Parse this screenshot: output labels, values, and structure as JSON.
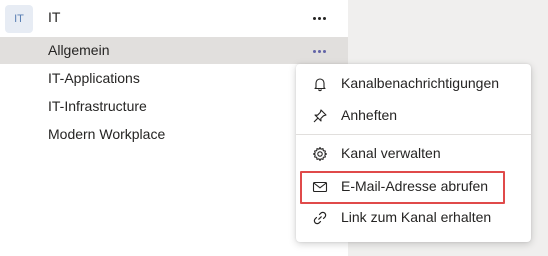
{
  "team": {
    "avatar_text": "IT",
    "name": "IT",
    "more_icon": "ellipsis-icon"
  },
  "channels": [
    {
      "label": "Allgemein",
      "selected": true
    },
    {
      "label": "IT-Applications",
      "selected": false
    },
    {
      "label": "IT-Infrastructure",
      "selected": false
    },
    {
      "label": "Modern Workplace",
      "selected": false
    }
  ],
  "context_menu": {
    "items": [
      {
        "label": "Kanalbenachrichtigungen",
        "icon": "bell-icon"
      },
      {
        "label": "Anheften",
        "icon": "pin-icon"
      },
      {
        "label": "Kanal verwalten",
        "icon": "gear-icon"
      },
      {
        "label": "E-Mail-Adresse abrufen",
        "icon": "mail-icon",
        "highlighted": true
      },
      {
        "label": "Link zum Kanal erhalten",
        "icon": "link-icon"
      }
    ]
  },
  "colors": {
    "accent": "#6264a7",
    "highlight_border": "#e04a4a",
    "selected_row": "#e1dfdd"
  }
}
